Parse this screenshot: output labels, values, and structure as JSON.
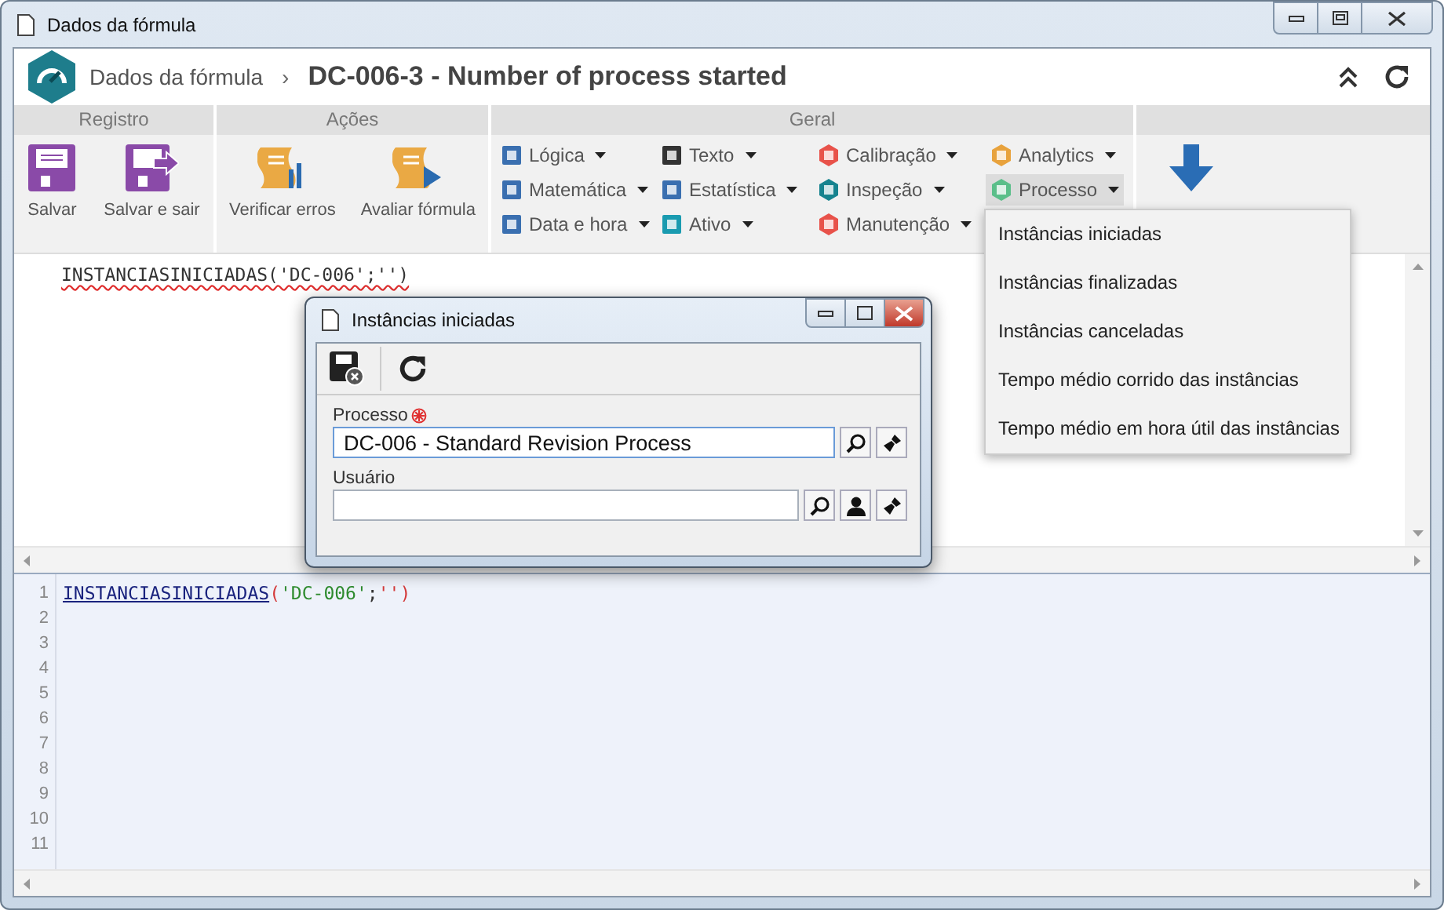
{
  "window": {
    "title": "Dados da fórmula"
  },
  "header": {
    "breadcrumb": "Dados da fórmula",
    "separator": "›",
    "title": "DC-006-3 - Number of process started"
  },
  "ribbon": {
    "registro": {
      "label": "Registro",
      "buttons": [
        {
          "label": "Salvar"
        },
        {
          "label": "Salvar e sair"
        }
      ]
    },
    "acoes": {
      "label": "Ações",
      "buttons": [
        {
          "label": "Verificar erros"
        },
        {
          "label": "Avaliar fórmula"
        }
      ]
    },
    "geral": {
      "label": "Geral",
      "columns": [
        [
          {
            "label": "Lógica",
            "selected": false
          },
          {
            "label": "Matemática",
            "selected": false
          },
          {
            "label": "Data e hora",
            "selected": false
          }
        ],
        [
          {
            "label": "Texto",
            "selected": false
          },
          {
            "label": "Estatística",
            "selected": false
          },
          {
            "label": "Ativo",
            "selected": false
          }
        ],
        [
          {
            "label": "Calibração",
            "selected": false
          },
          {
            "label": "Inspeção",
            "selected": false
          },
          {
            "label": "Manutenção",
            "selected": false
          }
        ],
        [
          {
            "label": "Analytics",
            "selected": false
          },
          {
            "label": "Processo",
            "selected": true
          }
        ]
      ]
    }
  },
  "editor": {
    "text": "INSTANCIASINICIADAS('DC-006';'')"
  },
  "preview": {
    "lines": [
      [
        {
          "text": "INSTANCIASINICIADAS",
          "kind": "function"
        },
        {
          "text": "(",
          "kind": "paren"
        },
        {
          "text": "'DC-006'",
          "kind": "string"
        },
        {
          "text": ";",
          "kind": "plain"
        },
        {
          "text": "''",
          "kind": "string_empty"
        },
        {
          "text": ")",
          "kind": "paren"
        }
      ]
    ],
    "line_numbers": [
      "1",
      "2",
      "3",
      "4",
      "5",
      "6",
      "7",
      "8",
      "9",
      "10",
      "11"
    ]
  },
  "dialog": {
    "title": "Instâncias iniciadas",
    "fields": [
      {
        "label": "Processo",
        "required": true,
        "value": "DC-006 - Standard Revision Process",
        "user_button": false
      },
      {
        "label": "Usuário",
        "required": false,
        "user_button": true
      }
    ]
  },
  "menu": {
    "items": [
      {
        "label": "Instâncias iniciadas"
      },
      {
        "label": "Instâncias finalizadas"
      },
      {
        "label": "Instâncias canceladas"
      },
      {
        "label": "Tempo médio corrido das instâncias"
      },
      {
        "label": "Tempo médio em hora útil das instâncias"
      }
    ]
  }
}
